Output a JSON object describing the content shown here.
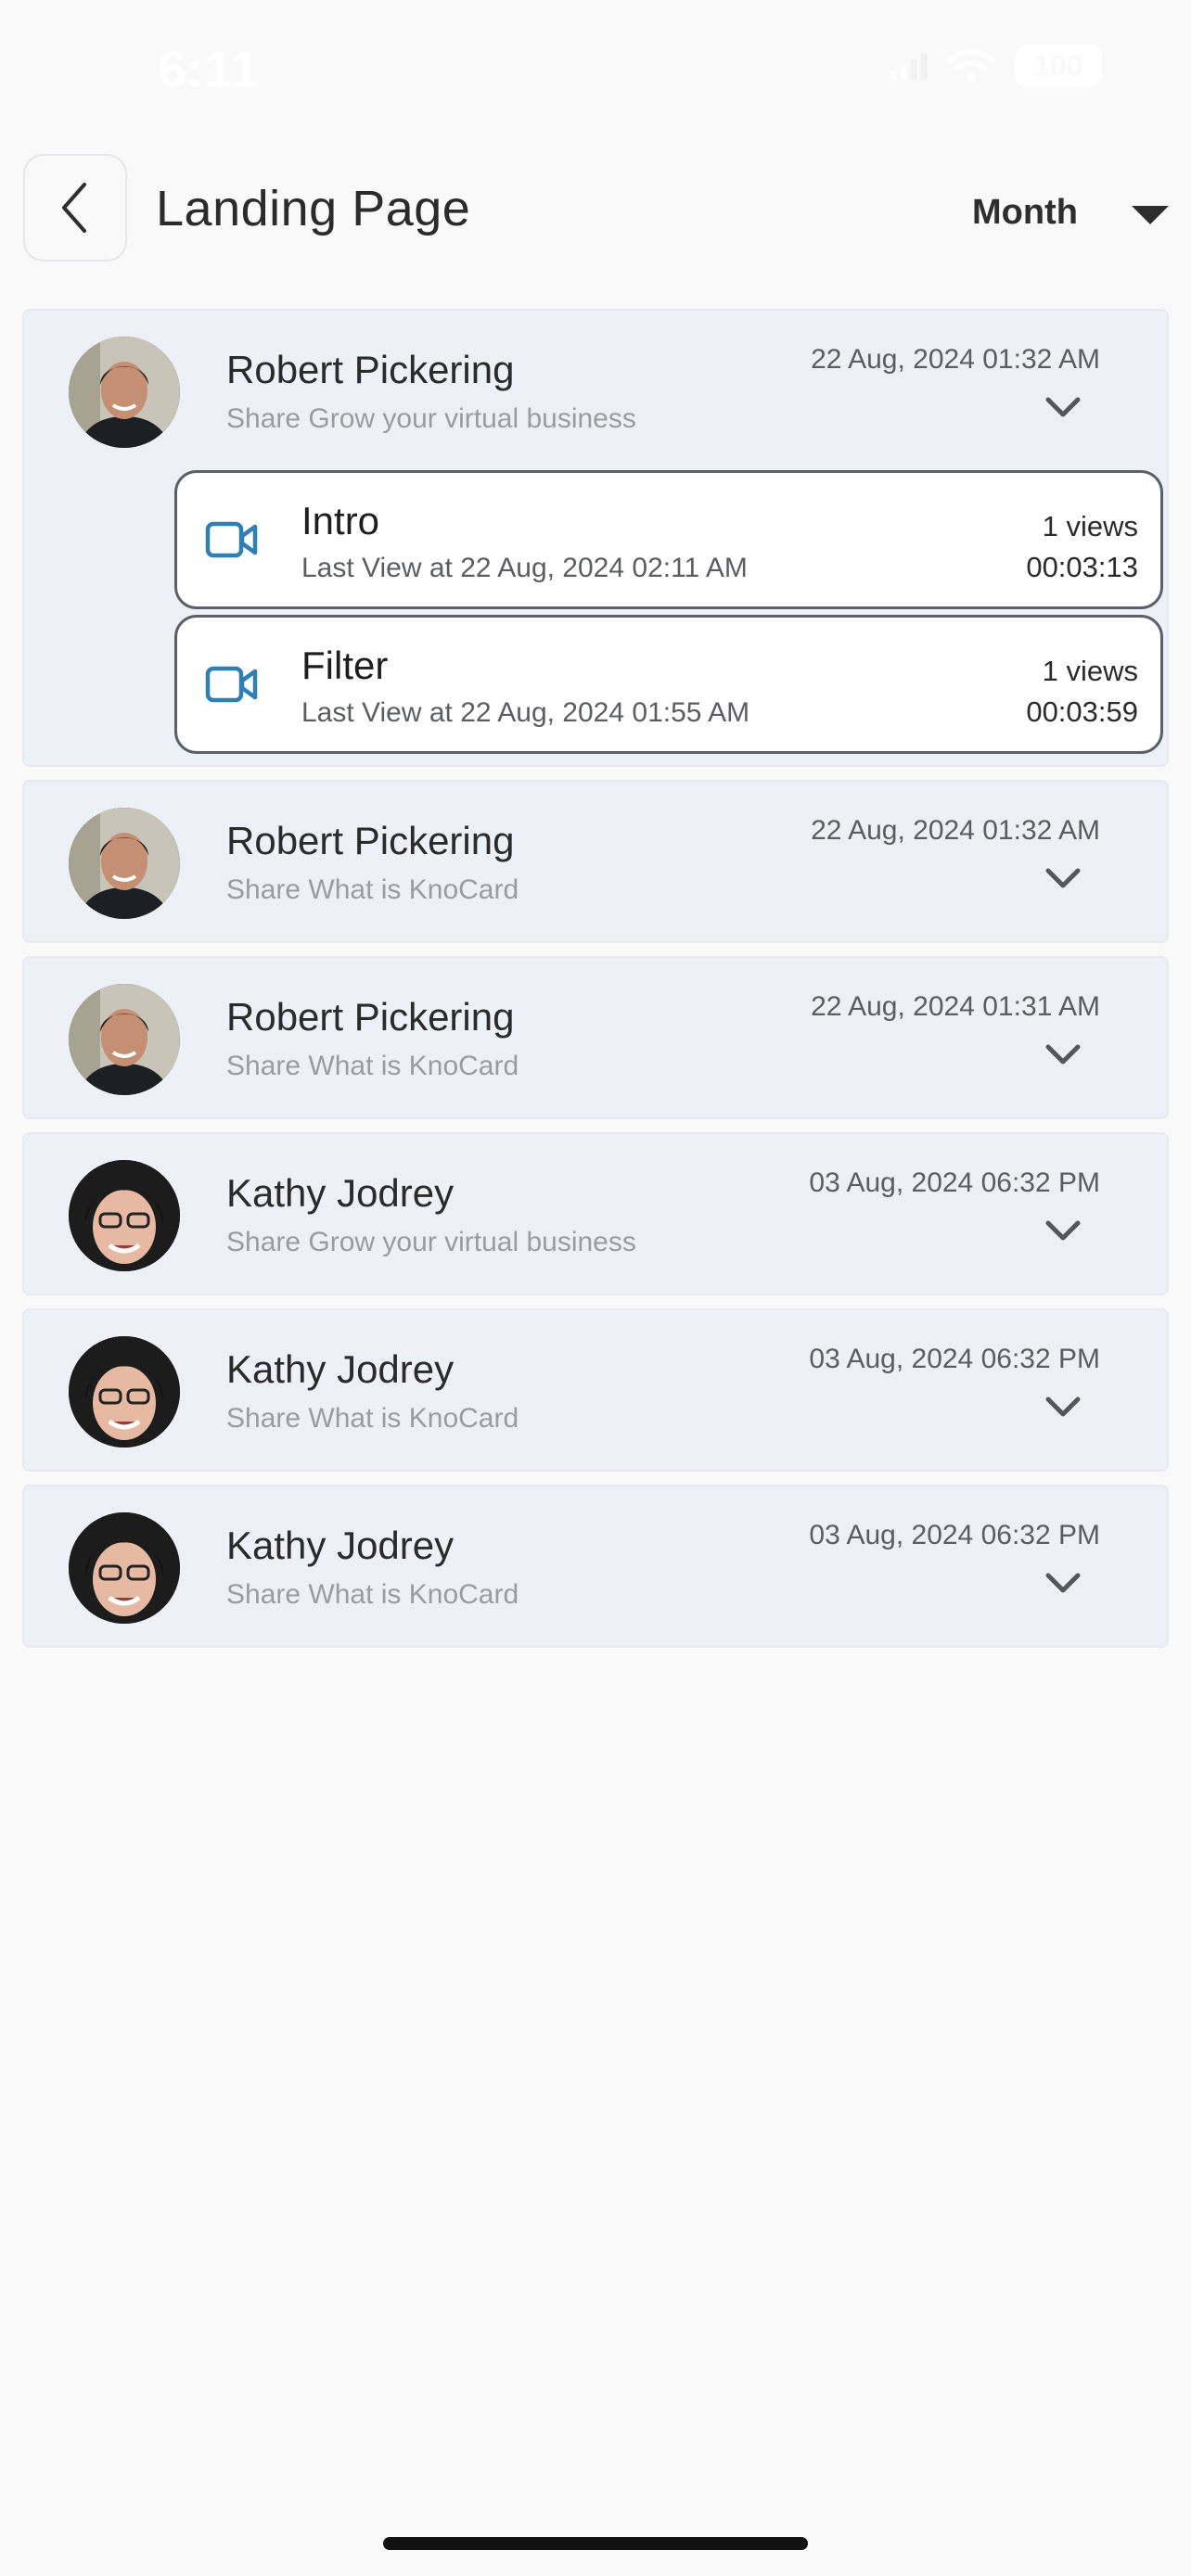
{
  "status_bar": {
    "time": "6:11",
    "battery": "100"
  },
  "header": {
    "title": "Landing Page",
    "period": "Month"
  },
  "items": [
    {
      "name": "Robert Pickering",
      "subtitle": "Share Grow your virtual business",
      "date": "22 Aug, 2024 01:32 AM",
      "avatar": "man",
      "expanded": true,
      "videos": [
        {
          "title": "Intro",
          "last_view": "Last View at 22 Aug, 2024 02:11 AM",
          "views": "1 views",
          "duration": "00:03:13"
        },
        {
          "title": "Filter",
          "last_view": "Last View at 22 Aug, 2024 01:55 AM",
          "views": "1 views",
          "duration": "00:03:59"
        }
      ]
    },
    {
      "name": "Robert Pickering",
      "subtitle": "Share What is KnoCard",
      "date": "22 Aug, 2024 01:32 AM",
      "avatar": "man",
      "expanded": false
    },
    {
      "name": "Robert Pickering",
      "subtitle": "Share What is KnoCard",
      "date": "22 Aug, 2024 01:31 AM",
      "avatar": "man",
      "expanded": false
    },
    {
      "name": "Kathy Jodrey",
      "subtitle": "Share Grow your virtual business",
      "date": "03 Aug, 2024 06:32 PM",
      "avatar": "woman",
      "expanded": false
    },
    {
      "name": "Kathy Jodrey",
      "subtitle": "Share What is KnoCard",
      "date": "03 Aug, 2024 06:32 PM",
      "avatar": "woman",
      "expanded": false
    },
    {
      "name": "Kathy Jodrey",
      "subtitle": "Share What is KnoCard",
      "date": "03 Aug, 2024 06:32 PM",
      "avatar": "woman",
      "expanded": false
    }
  ],
  "colors": {
    "card_bg": "#edf0f6",
    "video_icon": "#2f7fb5",
    "page_bg": "#f9f9f9"
  }
}
